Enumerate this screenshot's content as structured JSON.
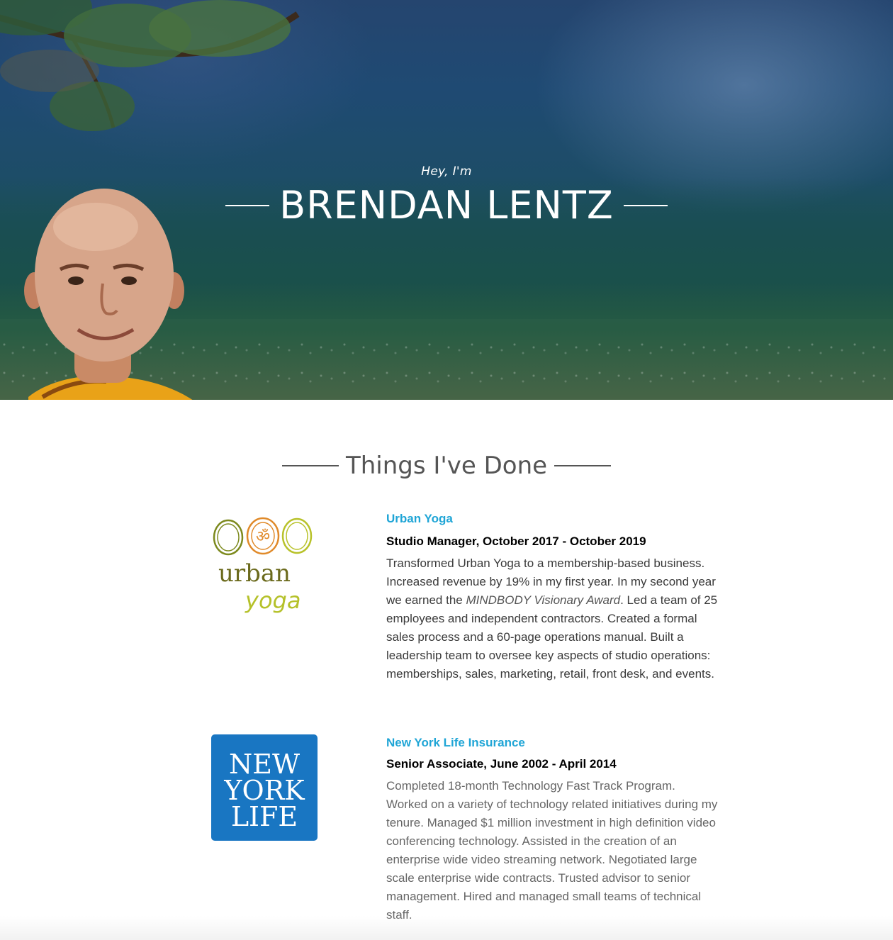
{
  "hero": {
    "greeting": "Hey, I'm",
    "name": "BRENDAN LENTZ"
  },
  "section": {
    "title": "Things I've Done"
  },
  "jobs": [
    {
      "company": "Urban Yoga",
      "role": "Studio Manager, October 2017 - October 2019",
      "desc_before": "Transformed Urban Yoga to a membership-based business. Increased revenue by 19% in my first year. In my second year we earned the ",
      "desc_award": "MINDBODY Visionary Award",
      "desc_after": ". Led a team of 25 employees and independent contractors. Created a formal sales process and a 60-page operations manual. Built a leadership team to oversee key aspects of studio operations: memberships, sales, marketing, retail, front desk, and events.",
      "logo": {
        "icon": "om-symbol-icon",
        "word1": "urban",
        "word2": "yoga",
        "ring_colors": [
          "#7d8a1e",
          "#e08a2a",
          "#b8c22a"
        ],
        "word1_color": "#6b6a1c",
        "word2_color": "#b5c12a"
      }
    },
    {
      "company": "New York Life Insurance",
      "role": "Senior Associate, June 2002 - April 2014",
      "desc": "Completed 18-month Technology Fast Track Program. Worked on a variety of technology related initiatives during my tenure. Managed $1 million investment in high definition video conferencing technology. Assisted in the creation of an enterprise wide video streaming network. Negotiated large scale enterprise wide contracts. Trusted advisor to senior management. Hired and managed small teams of technical staff.",
      "logo": {
        "lines": [
          "NEW",
          "YORK",
          "LIFE"
        ],
        "bg_color": "#1976c2"
      }
    }
  ],
  "colors": {
    "company_link": "#1fa5d6",
    "heading_gray": "#555555"
  }
}
